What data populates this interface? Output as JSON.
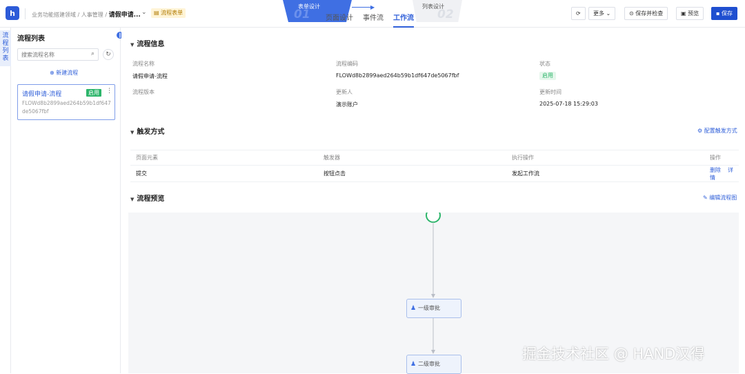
{
  "topbar": {
    "breadcrumb": "业务功能搭建领域 / 人事管理 /",
    "current_page": "请假申请...",
    "flow_tag": "流程表单",
    "steps": [
      {
        "label": "表单设计",
        "num": "01"
      },
      {
        "label": "列表设计",
        "num": "02"
      }
    ],
    "tabs": [
      "页面设计",
      "事件流",
      "工作流"
    ],
    "buttons": {
      "more": "更多",
      "save_check": "保存并检查",
      "preview": "预览",
      "save": "保存"
    }
  },
  "vertical_tab": "流程列表",
  "flow_list": {
    "title": "流程列表",
    "search_placeholder": "搜索流程名称",
    "new_flow": "新建流程",
    "items": [
      {
        "name": "请假申请-流程",
        "status": "启用",
        "code": "FLOWd8b2899aed264b59b1df647de5067fbf"
      }
    ]
  },
  "flow_info": {
    "title": "流程信息",
    "fields": {
      "name_label": "流程名称",
      "name_value": "请假申请-流程",
      "code_label": "流程编码",
      "code_value": "FLOWd8b2899aed264b59b1df647de5067fbf",
      "status_label": "状态",
      "status_value": "启用",
      "version_label": "流程版本",
      "updater_label": "更新人",
      "updater_value": "演示账户",
      "updated_label": "更新时间",
      "updated_value": "2025-07-18 15:29:03"
    }
  },
  "trigger": {
    "title": "触发方式",
    "config_link": "配置触发方式",
    "columns": [
      "页面元素",
      "触发器",
      "执行操作",
      "操作"
    ],
    "rows": [
      {
        "element": "提交",
        "trigger": "按钮点击",
        "action": "发起工作流",
        "ops": [
          "删除",
          "详情"
        ]
      }
    ]
  },
  "preview": {
    "title": "流程预览",
    "edit_link": "编辑流程图",
    "nodes": [
      "一级审批",
      "二级审批"
    ]
  },
  "watermark": "掘金技术社区 @ HAND汉得",
  "colors": {
    "primary": "#1f4fd0",
    "accent": "#2f5fd9",
    "success": "#2cb56a"
  }
}
